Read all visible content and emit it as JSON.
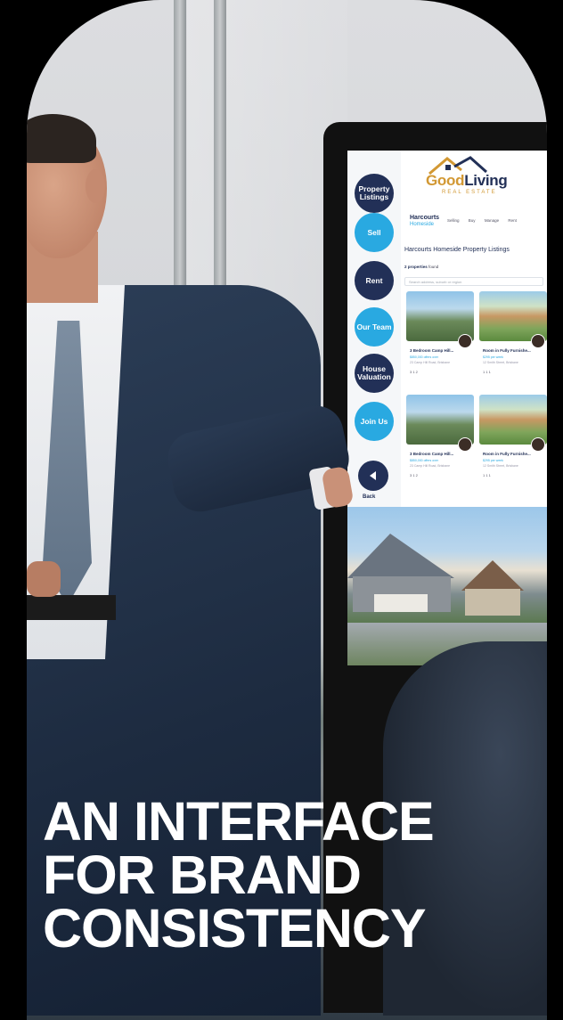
{
  "kiosk": {
    "nav": {
      "property_listings": "Property Listings",
      "sell": "Sell",
      "rent": "Rent",
      "our_team": "Our Team",
      "house_valuation": "House Valuation",
      "join_us": "Join Us",
      "back": "Back"
    },
    "logo": {
      "good": "Good",
      "living": "Living",
      "subtitle": "REAL ESTATE"
    },
    "brand": {
      "name": "Harcourts",
      "sub": "Homeside"
    },
    "menu": [
      "Selling",
      "Buy",
      "Manage",
      "Rent"
    ],
    "page_title": "Harcourts Homeside Property Listings",
    "found": {
      "count": "2 properties",
      "suffix": "found"
    },
    "search_placeholder": "Search address, suburb or region",
    "cards": [
      {
        "title": "3 Bedroom Camp Hill...",
        "price": "$850,000 offers over",
        "addr": "23 Camp Hill Road, Brisbane",
        "meta": "3   1   2"
      },
      {
        "title": "Room in Fully Furnishe...",
        "price": "$295 per week",
        "addr": "12 Smith Street, Brisbane",
        "meta": "1   1   1"
      },
      {
        "title": "3 Bedroom Camp Hill...",
        "price": "$850,000 offers over",
        "addr": "23 Camp Hill Road, Brisbane",
        "meta": "3   1   2"
      },
      {
        "title": "Room in Fully Furnishe...",
        "price": "$295 per week",
        "addr": "12 Smith Street, Brisbane",
        "meta": "1   1   1"
      }
    ]
  },
  "headline": {
    "line1": "AN INTERFACE",
    "line2": "FOR BRAND",
    "line3": "CONSISTENCY"
  },
  "colors": {
    "navy": "#223057",
    "sky": "#29a9e1",
    "gold": "#d29833"
  }
}
